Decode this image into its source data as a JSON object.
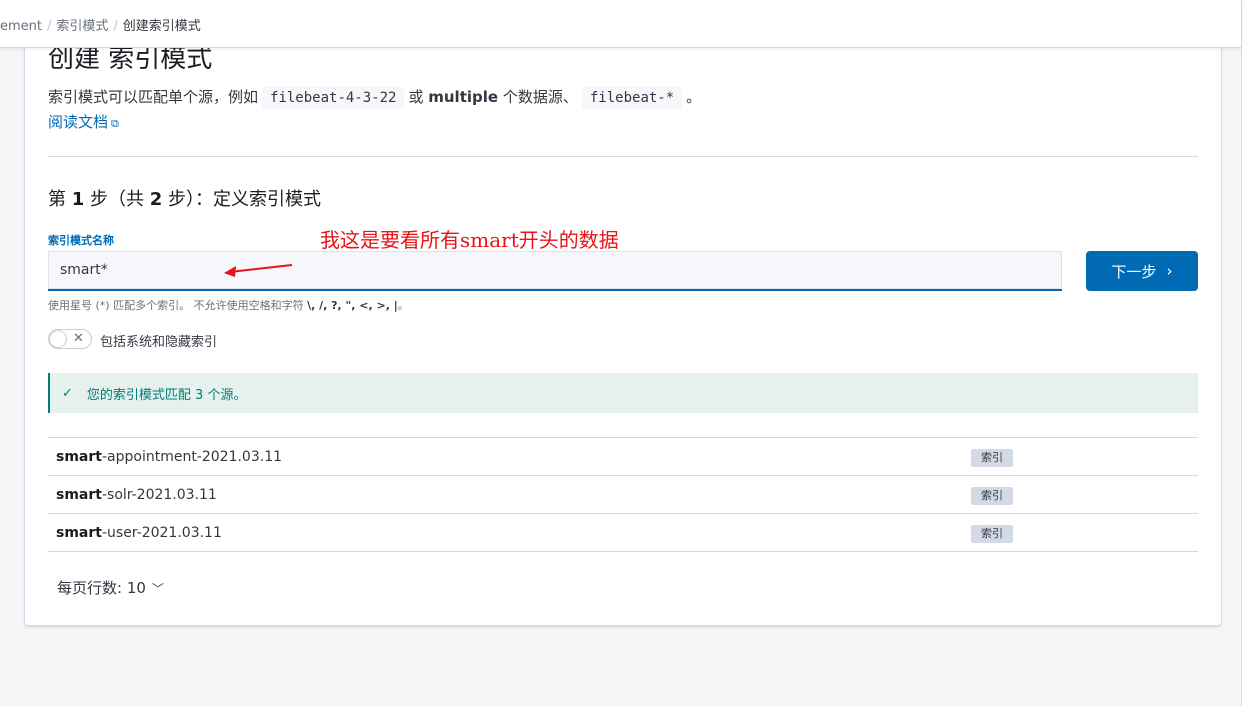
{
  "breadcrumb": [
    "ement",
    "索引模式",
    "创建索引模式"
  ],
  "title": "创建 索引模式",
  "description": {
    "prefix": "索引模式可以匹配单个源，例如",
    "code1": "filebeat-4-3-22",
    "mid": "或",
    "bold": "multiple",
    "mid2": "个数据源、",
    "code2": "filebeat-*",
    "suffix": "。"
  },
  "doc_link": "阅读文档",
  "step": {
    "p1": "第",
    "n1": "1",
    "p2": "步（共",
    "n2": "2",
    "p3": "步）：定义索引模式"
  },
  "field_label": "索引模式名称",
  "input_value": "smart*",
  "annotation": "我这是要看所有smart开头的数据",
  "next_button": "下一步",
  "help_text": {
    "prefix": "使用星号 (*) 匹配多个索引。 不允许使用空格和字符",
    "chars": "\\, /, ?, \", <, >, |",
    "suffix": "。"
  },
  "toggle_label": "包括系统和隐藏索引",
  "callout": "您的索引模式匹配 3 个源。",
  "indices": [
    {
      "bold": "smart",
      "rest": "-appointment-2021.03.11",
      "badge": "索引"
    },
    {
      "bold": "smart",
      "rest": "-solr-2021.03.11",
      "badge": "索引"
    },
    {
      "bold": "smart",
      "rest": "-user-2021.03.11",
      "badge": "索引"
    }
  ],
  "rows_per_page": "每页行数: 10",
  "colors": {
    "primary": "#006bb4",
    "success": "#017d73",
    "annotation": "#e8141a"
  }
}
